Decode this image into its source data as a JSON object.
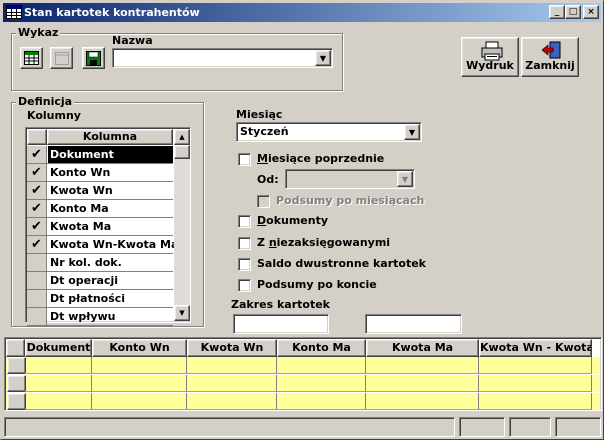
{
  "window": {
    "title": "Stan kartotek kontrahentów",
    "app_icon": "spreadsheet-icon",
    "controls": {
      "minimize": "_",
      "maximize": "□",
      "close": "×"
    }
  },
  "wykaz": {
    "group_title": "Wykaz",
    "toolbar_icons": [
      "table-icon",
      "blank-page-icon",
      "save-disk-icon"
    ],
    "nazwa_label": "Nazwa",
    "nazwa_value": ""
  },
  "buttons": {
    "print_label": "Wydruk",
    "close_label": "Zamknij"
  },
  "definicja": {
    "group_title": "Definicja",
    "columns_label": "Kolumny",
    "list_header": "Kolumna",
    "items": [
      {
        "label": "Dokument",
        "checked": true,
        "selected": true
      },
      {
        "label": "Konto Wn",
        "checked": true,
        "selected": false
      },
      {
        "label": "Kwota Wn",
        "checked": true,
        "selected": false
      },
      {
        "label": "Konto Ma",
        "checked": true,
        "selected": false
      },
      {
        "label": "Kwota Ma",
        "checked": true,
        "selected": false
      },
      {
        "label": "Kwota Wn-Kwota Ma",
        "checked": true,
        "selected": false
      },
      {
        "label": "Nr kol. dok.",
        "checked": false,
        "selected": false
      },
      {
        "label": "Dt operacji",
        "checked": false,
        "selected": false
      },
      {
        "label": "Dt płatności",
        "checked": false,
        "selected": false
      },
      {
        "label": "Dt wpływu",
        "checked": false,
        "selected": false
      }
    ],
    "check_glyph": "✔"
  },
  "miesiac": {
    "label": "Miesiąc",
    "value": "Styczeń"
  },
  "options": {
    "prev_months": {
      "label_u": "M",
      "label_rest": "iesiące poprzednie",
      "checked": false
    },
    "od_label": "Od:",
    "od_value": "",
    "sums_by_month": {
      "label": "Podsumy po miesiącach",
      "checked": false,
      "disabled": true
    },
    "documents": {
      "label_u": "D",
      "label_rest": "okumenty",
      "checked": false
    },
    "unposted": {
      "label_pre": "Z ",
      "label_u": "n",
      "label_rest": "iezaksięgowanymi",
      "checked": false
    },
    "two_sided": {
      "label": "Saldo dwustronne kartotek",
      "checked": false
    },
    "sums_by_account": {
      "label": "Podsumy po koncie",
      "checked": false
    }
  },
  "zakres": {
    "label": "Zakres kartotek",
    "from": "",
    "to": ""
  },
  "grid": {
    "columns": [
      "Dokument",
      "Konto Wn",
      "Kwota Wn",
      "Konto Ma",
      "Kwota Ma",
      "Kwota Wn - Kwota"
    ],
    "row_count": 3,
    "row_color": "#ffff99"
  },
  "colors": {
    "title_gradient_start": "#0a246a",
    "title_gradient_end": "#a6caf0",
    "face": "#d4d0c8",
    "grid_row": "#ffff99"
  }
}
